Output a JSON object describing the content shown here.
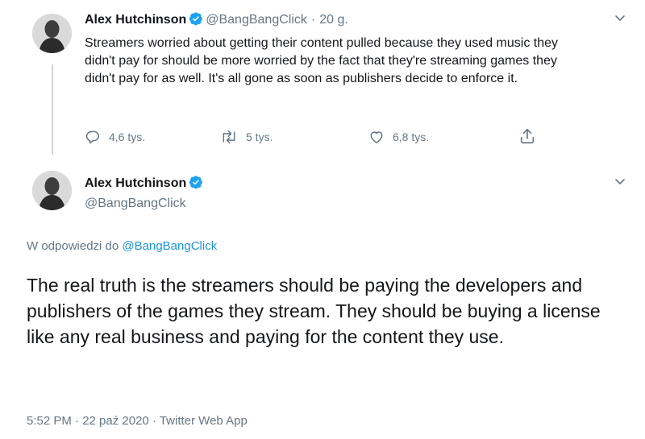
{
  "first_tweet": {
    "author_name": "Alex Hutchinson",
    "handle": "@BangBangClick",
    "separator": "·",
    "time": "20 g.",
    "text": "Streamers worried about getting their content pulled because they used music they didn't pay for should be more worried by the fact that they're streaming games they didn't pay for as well. It's all gone as soon as publishers decide to enforce it.",
    "replies": "4,6 tys.",
    "retweets": "5 tys.",
    "likes": "6,8 tys.",
    "icons": [
      "verified-badge-icon",
      "chevron-down-icon",
      "reply-icon",
      "retweet-icon",
      "like-icon",
      "share-icon"
    ]
  },
  "second_tweet": {
    "author_name": "Alex Hutchinson",
    "handle": "@BangBangClick",
    "reply_prefix": "W odpowiedzi do",
    "reply_to": "@BangBangClick",
    "text": "The real truth is the streamers should be paying the developers and publishers of the games they stream. They should be buying a license like any real business and paying for the content they use.",
    "timestamp": "5:52 PM · 22 paź 2020",
    "separator": "·",
    "source": "Twitter Web App"
  },
  "colors": {
    "accent": "#1b95e0",
    "muted": "#657786",
    "text": "#14171a",
    "verified": "#1da1f2"
  }
}
